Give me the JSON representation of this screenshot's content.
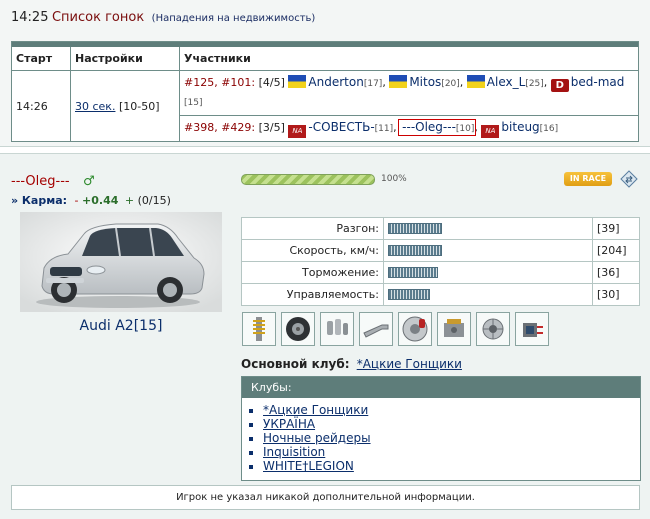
{
  "races": {
    "time": "14:25",
    "title": "Список гонок",
    "subtitle": "(Нападения на недвижимость)",
    "columns": [
      "Старт",
      "Настройки",
      "Участники"
    ],
    "row": {
      "start": "14:26",
      "setting_link": "30 сек.",
      "setting_range": "[10-50]",
      "group1": {
        "ids": "#125, #101:",
        "count": "[4/5]",
        "participants": [
          {
            "name": "Anderton",
            "level": "[17]",
            "flag": "UA"
          },
          {
            "name": "Mitos",
            "level": "[20]",
            "flag": "UA"
          },
          {
            "name": "Alex_L",
            "level": "[25]",
            "flag": "UA"
          },
          {
            "name": "bed-mad",
            "level": "[15]",
            "flag": "D"
          }
        ]
      },
      "group2": {
        "ids": "#398, #429:",
        "count": "[3/5]",
        "participants": [
          {
            "name": "-СОВЕСТЬ-",
            "level": "[11]",
            "flag": "NA"
          },
          {
            "name": "---Oleg---",
            "level": "[10]",
            "flag": "",
            "highlighted": true
          },
          {
            "name": "biteug",
            "level": "[16]",
            "flag": "NA"
          }
        ]
      }
    }
  },
  "profile": {
    "name": "---Oleg---",
    "karma_label": "» Карма:",
    "karma_minus": "-",
    "karma_value": "+0.44",
    "karma_plus": "+",
    "karma_count": "(0/15)",
    "progress_fraction": 1.0,
    "progress_label": "100%",
    "status_badge": "IN RACE",
    "car_name": "Audi A2[15]",
    "stats": [
      {
        "label": "Разгон:",
        "value": "[39]",
        "fraction": 0.27
      },
      {
        "label": "Скорость, км/ч:",
        "value": "[204]",
        "fraction": 0.27
      },
      {
        "label": "Торможение:",
        "value": "[36]",
        "fraction": 0.25
      },
      {
        "label": "Управляемость:",
        "value": "[30]",
        "fraction": 0.21
      }
    ],
    "parts_icons": [
      "suspension-icon",
      "tire-icon",
      "pedals-icon",
      "exhaust-icon",
      "brake-disc-icon",
      "engine-icon",
      "turbo-icon",
      "ecu-icon"
    ],
    "main_club_label": "Основной клуб:",
    "main_club": "*Ацкие Гонщики",
    "clubs_header": "Клубы:",
    "clubs": [
      "*Ацкие Гонщики",
      "УКРАЇНА",
      "Ночные рейдеры",
      "Inquisition",
      "WHITE†LEGION"
    ],
    "info_text": "Игрок не указал никакой дополнительной информации."
  },
  "colors": {
    "accent_teal": "#5e7d7a",
    "link_blue": "#0b2e6b",
    "title_red": "#7a0d0d",
    "player_red": "#a40000",
    "karma_green": "#2b6e2b"
  }
}
